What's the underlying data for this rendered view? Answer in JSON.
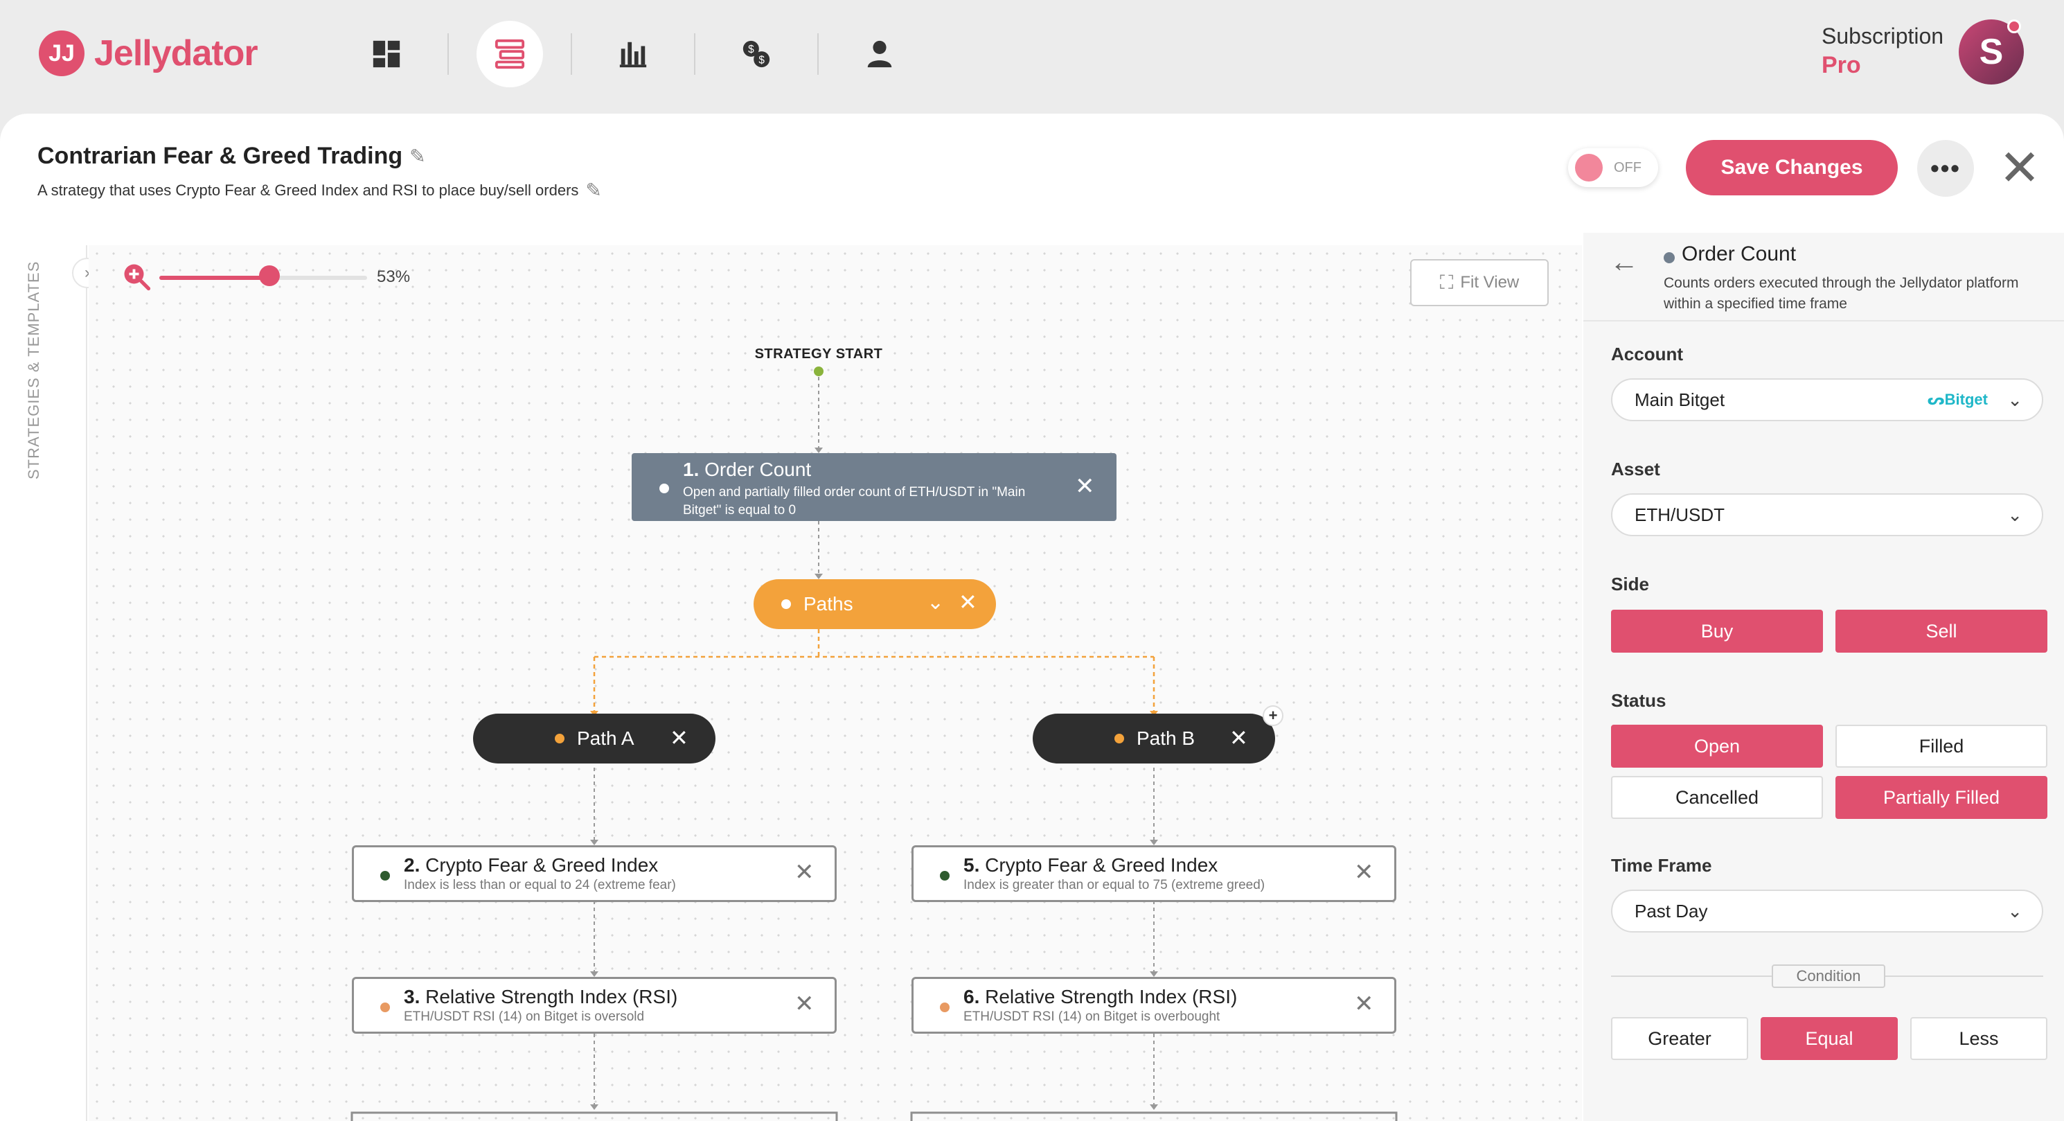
{
  "app": {
    "name": "Jellydator",
    "logo_mark": "JJ",
    "nav": [
      {
        "name": "dashboard-icon"
      },
      {
        "name": "strategies-icon"
      },
      {
        "name": "analytics-icon"
      },
      {
        "name": "exchange-icon"
      },
      {
        "name": "account-icon"
      }
    ]
  },
  "subscription": {
    "label": "Subscription",
    "plan": "Pro",
    "avatar_initial": "S"
  },
  "strategy": {
    "title": "Contrarian Fear & Greed Trading",
    "description": "A strategy that uses Crypto Fear & Greed Index and RSI to place buy/sell orders",
    "toggle_label": "OFF",
    "save_label": "Save Changes",
    "more_label": "•••",
    "close_label": "✕"
  },
  "sidebar": {
    "label": "STRATEGIES & TEMPLATES",
    "toggle": "›"
  },
  "canvas": {
    "zoom_percent": 53,
    "zoom_label": "53%",
    "zoom_fraction": 0.53,
    "fit_view": "Fit View",
    "start_label": "STRATEGY START"
  },
  "nodes": {
    "order_count": {
      "num": "1.",
      "title": "Order Count",
      "subtitle_1": "Open and partially filled order count of ETH/USDT in \"Main",
      "subtitle_2": "Bitget\" is equal to 0"
    },
    "paths": {
      "label": "Paths"
    },
    "path_a": {
      "label": "Path A"
    },
    "path_b": {
      "label": "Path B"
    },
    "conditions": [
      {
        "num": "2.",
        "title": "Crypto Fear & Greed Index",
        "subtitle": "Index is less than or equal to 24 (extreme fear)",
        "dot_color": "#2e5b2e"
      },
      {
        "num": "3.",
        "title": "Relative Strength Index (RSI)",
        "subtitle": "ETH/USDT RSI (14) on Bitget is oversold",
        "dot_color": "#e89a62"
      },
      {
        "num": "5.",
        "title": "Crypto Fear & Greed Index",
        "subtitle": "Index is greater than or equal to 75 (extreme greed)",
        "dot_color": "#2e5b2e"
      },
      {
        "num": "6.",
        "title": "Relative Strength Index (RSI)",
        "subtitle": "ETH/USDT RSI (14) on Bitget is overbought",
        "dot_color": "#e89a62"
      }
    ]
  },
  "details": {
    "title": "Order Count",
    "description": "Counts orders executed through the Jellydator platform within a specified time frame",
    "account_label": "Account",
    "account_value": "Main Bitget",
    "account_brand": "Bitget",
    "asset_label": "Asset",
    "asset_value": "ETH/USDT",
    "side_label": "Side",
    "side_buy": "Buy",
    "side_sell": "Sell",
    "status_label": "Status",
    "status_open": "Open",
    "status_filled": "Filled",
    "status_cancelled": "Cancelled",
    "status_partial": "Partially Filled",
    "timeframe_label": "Time Frame",
    "timeframe_value": "Past Day",
    "condition_label": "Condition",
    "cond_greater": "Greater",
    "cond_equal": "Equal",
    "cond_less": "Less"
  },
  "colors": {
    "brand": "#e0506f",
    "paths": "#f3a23b",
    "node_gray": "#717f8e",
    "pill_dark": "#2e2e2e"
  }
}
